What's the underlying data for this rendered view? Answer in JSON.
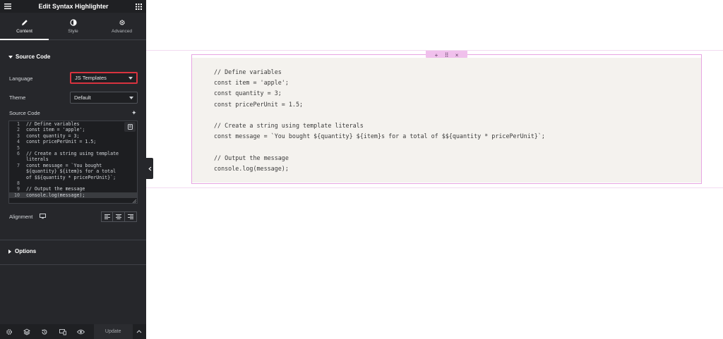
{
  "panel": {
    "title": "Edit Syntax Highlighter",
    "tabs": [
      {
        "label": "Content",
        "icon": "pencil-icon",
        "active": true
      },
      {
        "label": "Style",
        "icon": "half-circle-icon",
        "active": false
      },
      {
        "label": "Advanced",
        "icon": "gear-icon",
        "active": false
      }
    ],
    "section_title": "Source Code",
    "language_label": "Language",
    "language_value": "JS Templates",
    "theme_label": "Theme",
    "theme_value": "Default",
    "source_code_label": "Source Code",
    "code_lines": [
      {
        "n": "1",
        "text": "// Define variables"
      },
      {
        "n": "2",
        "text": "const item = 'apple';"
      },
      {
        "n": "3",
        "text": "const quantity = 3;"
      },
      {
        "n": "4",
        "text": "const pricePerUnit = 1.5;"
      },
      {
        "n": "5",
        "text": ""
      },
      {
        "n": "6",
        "text": "// Create a string using template literals"
      },
      {
        "n": "7",
        "text": "const message = `You bought ${quantity} ${item}s for a total of $${quantity * pricePerUnit}`;"
      },
      {
        "n": "8",
        "text": ""
      },
      {
        "n": "9",
        "text": "// Output the message"
      },
      {
        "n": "10",
        "text": "console.log(message);"
      }
    ],
    "alignment_label": "Alignment",
    "options_title": "Options",
    "update_label": "Update"
  },
  "canvas": {
    "code_lines": [
      "// Define variables",
      "const item = 'apple';",
      "const quantity = 3;",
      "const pricePerUnit = 1.5;",
      "",
      "// Create a string using template literals",
      "const message = `You bought ${quantity} ${item}s for a total of $${quantity * pricePerUnit}`;",
      "",
      "// Output the message",
      "console.log(message);"
    ],
    "toolbar": {
      "add": "+",
      "move": "⠿",
      "close": "×"
    }
  },
  "colors": {
    "panel_bg": "#26272b",
    "highlight_border": "#d9333f",
    "widget_outline": "#e7a5e2",
    "code_bg": "#f4f2ee"
  }
}
